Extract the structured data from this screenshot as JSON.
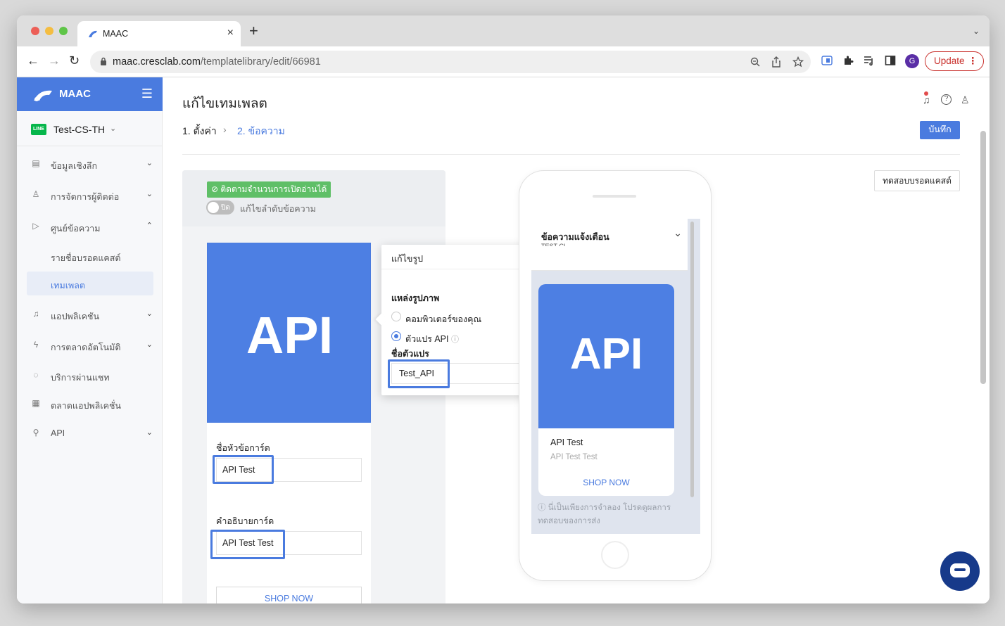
{
  "browser": {
    "tab_title": "MAAC",
    "tab_close": "×",
    "new_tab": "+",
    "tab_menu": "⌄",
    "url_host": "maac.cresclab.com",
    "url_path": "/templatelibrary/edit/66981",
    "profile_letter": "G",
    "update_label": "Update",
    "update_menu": "⋮",
    "nav_back": "←",
    "nav_forward": "→",
    "nav_reload": "↻"
  },
  "sidebar": {
    "brand": "MAAC",
    "menu_glyph": "☰",
    "account_badge": "LINE",
    "account_name": "Test-CS-TH",
    "account_caret": "⌄",
    "items": [
      {
        "icon": "chart-icon",
        "glyph": "▤",
        "label": "ข้อมูลเชิงลึก",
        "chevron": "⌄"
      },
      {
        "icon": "person-icon",
        "glyph": "♙",
        "label": "การจัดการผู้ติดต่อ",
        "chevron": "⌄"
      },
      {
        "icon": "send-icon",
        "glyph": "▷",
        "label": "ศูนย์ข้อความ",
        "chevron": "⌃"
      },
      {
        "label": "รายชื่อบรอดแคสต์"
      },
      {
        "label": "เทมเพลต"
      },
      {
        "icon": "bell-icon",
        "glyph": "♫",
        "label": "แอปพลิเคชัน",
        "chevron": "⌄"
      },
      {
        "icon": "lightning-icon",
        "glyph": "ϟ",
        "label": "การตลาดอัตโนมัติ",
        "chevron": "⌄"
      },
      {
        "icon": "chat-icon",
        "glyph": "◌",
        "label": "บริการผ่านแชท"
      },
      {
        "icon": "store-icon",
        "glyph": "▦",
        "label": "ตลาดแอปพลิเคชั่น"
      },
      {
        "icon": "link-icon",
        "glyph": "⚲",
        "label": "API",
        "chevron": "⌄"
      }
    ]
  },
  "header": {
    "title": "แก้ไขเทมเพลต",
    "bell_glyph": "♫",
    "help_glyph": "?",
    "user_glyph": "♙",
    "step1": "1. ตั้งค่า",
    "step_sep": "›",
    "step2": "2. ข้อความ",
    "save_label": "บันทึก",
    "test_broadcast_label": "ทดสอบบรอดแคสต์"
  },
  "editor": {
    "tracking_badge": "ติดตามจำนวนการเปิดอ่านได้",
    "toggle_state": "ปิด",
    "toggle_label": "แก้ไขลำดับข้อความ",
    "card_image_text": "API",
    "card_title_label": "ชื่อหัวข้อการ์ด",
    "card_title_value": "API Test",
    "card_desc_label": "คำอธิบายการ์ด",
    "card_desc_value": "API Test Test",
    "button_label": "SHOP NOW"
  },
  "popover": {
    "title": "แก้ไขรูป",
    "source_label": "แหล่งรูปภาพ",
    "option_computer": "คอมพิวเตอร์ของคุณ",
    "option_api": "ตัวแปร API",
    "info_glyph": "ⓘ",
    "variable_label": "ชื่อตัวแปร",
    "variable_value": "Test_API"
  },
  "preview": {
    "notification_label": "ข้อความแจ้งเตือน",
    "notification_sub": "TEST CI",
    "chevron": "⌄",
    "card_image_text": "API",
    "card_title": "API Test",
    "card_desc": "API Test Test",
    "card_button": "SHOP NOW",
    "note_icon": "ⓘ",
    "note": "นี่เป็นเพียงการจำลอง โปรดดูผลการทดสอบของการส่ง"
  }
}
